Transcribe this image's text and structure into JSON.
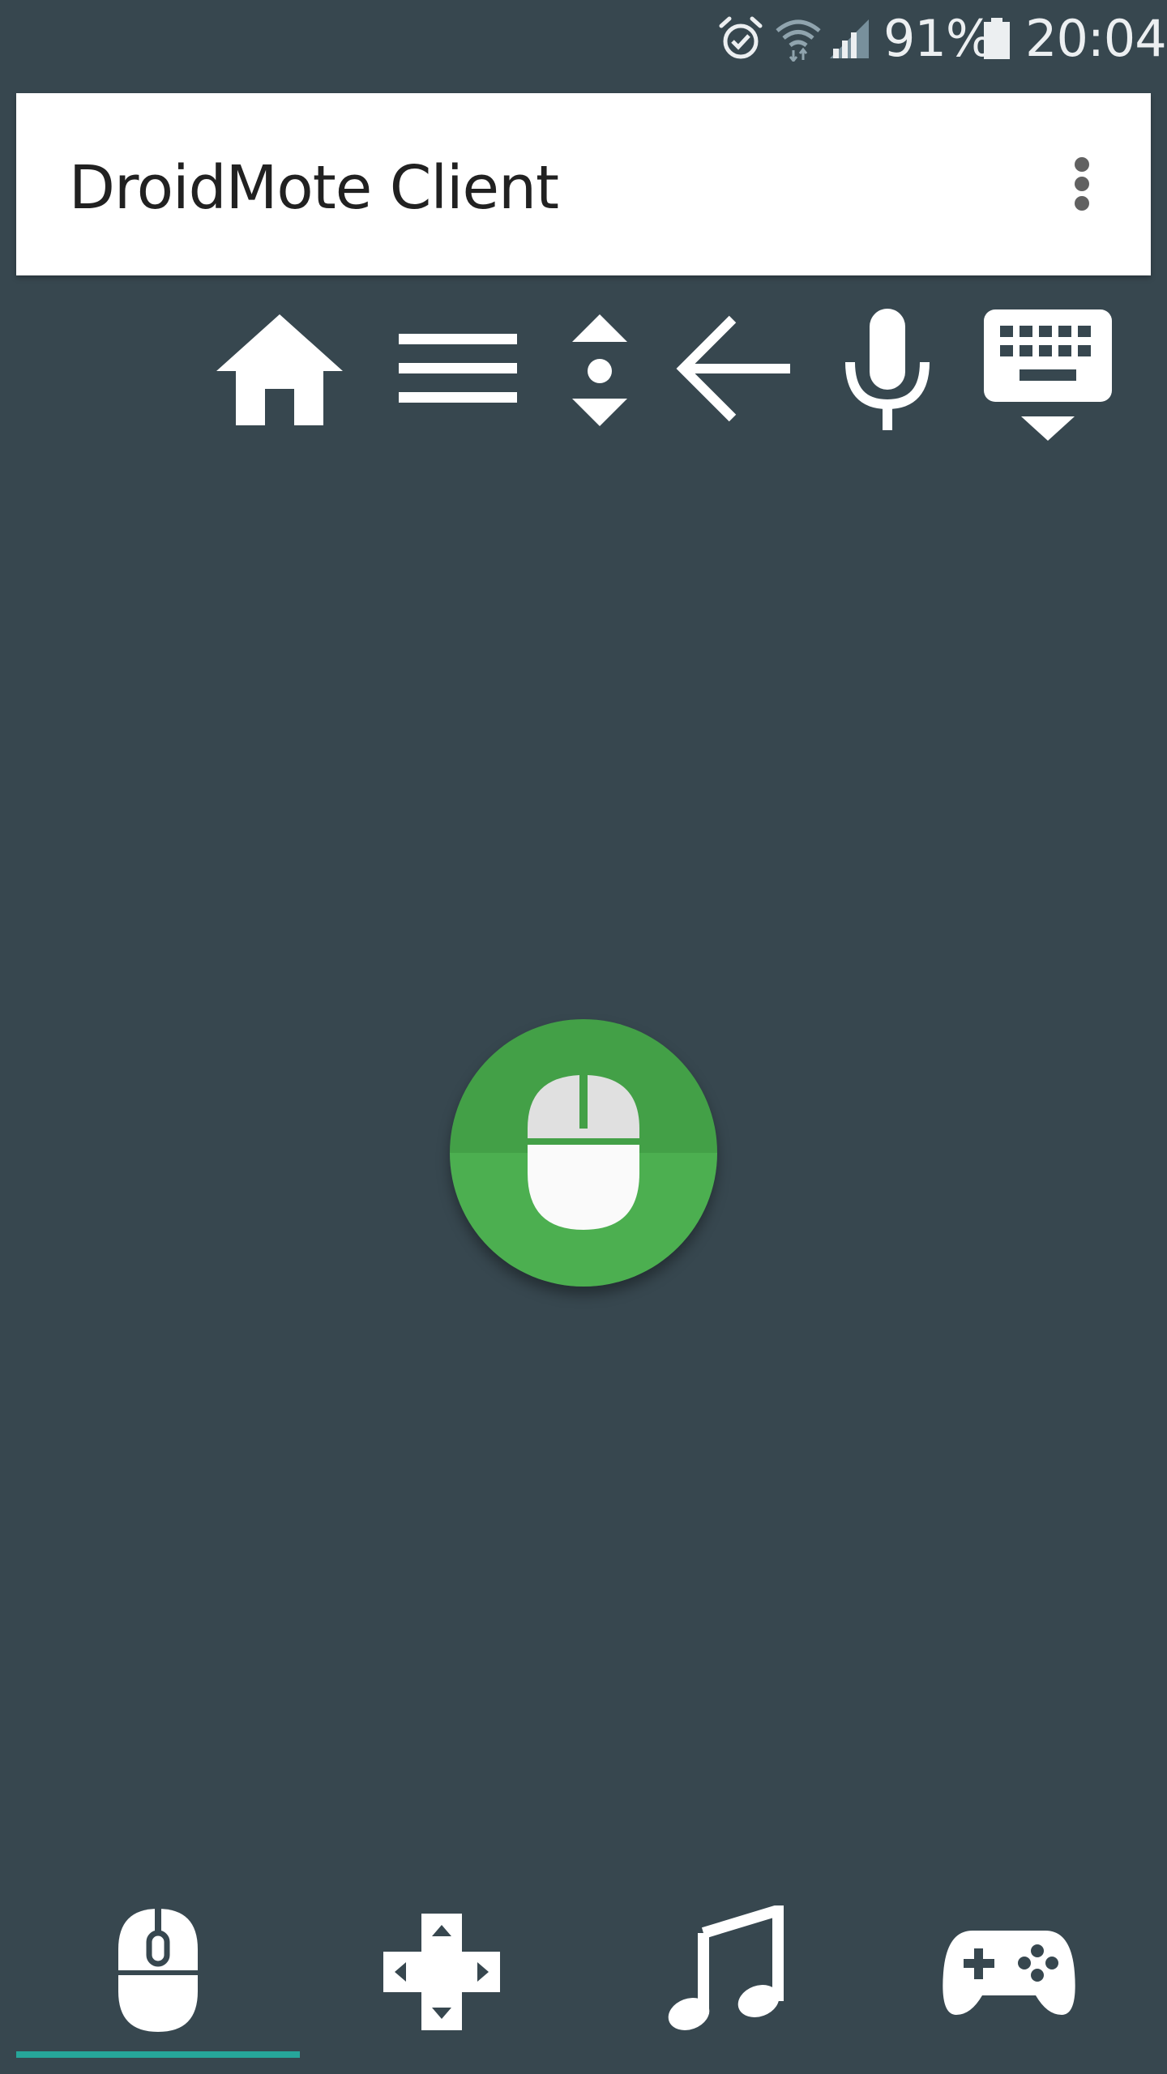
{
  "status_bar": {
    "battery_percent": "91%",
    "time": "20:04",
    "icons": [
      "alarm-icon",
      "wifi-icon",
      "signal-icon",
      "battery-icon"
    ]
  },
  "app_bar": {
    "title": "DroidMote Client",
    "overflow_icon": "more-vert-icon"
  },
  "toolbar": {
    "buttons": [
      "home-icon",
      "menu-icon",
      "scroll-icon",
      "back-arrow-icon",
      "mic-icon",
      "keyboard-icon"
    ]
  },
  "center_button": {
    "icon": "mouse-icon"
  },
  "bottom_tabs": {
    "items": [
      "mouse-icon",
      "dpad-icon",
      "music-note-icon",
      "gamepad-icon"
    ],
    "selected_index": 0
  },
  "colors": {
    "background": "#37474F",
    "app_bar": "#FFFFFF",
    "fab_green": "#4CAF50",
    "tab_indicator": "#26A69A"
  }
}
